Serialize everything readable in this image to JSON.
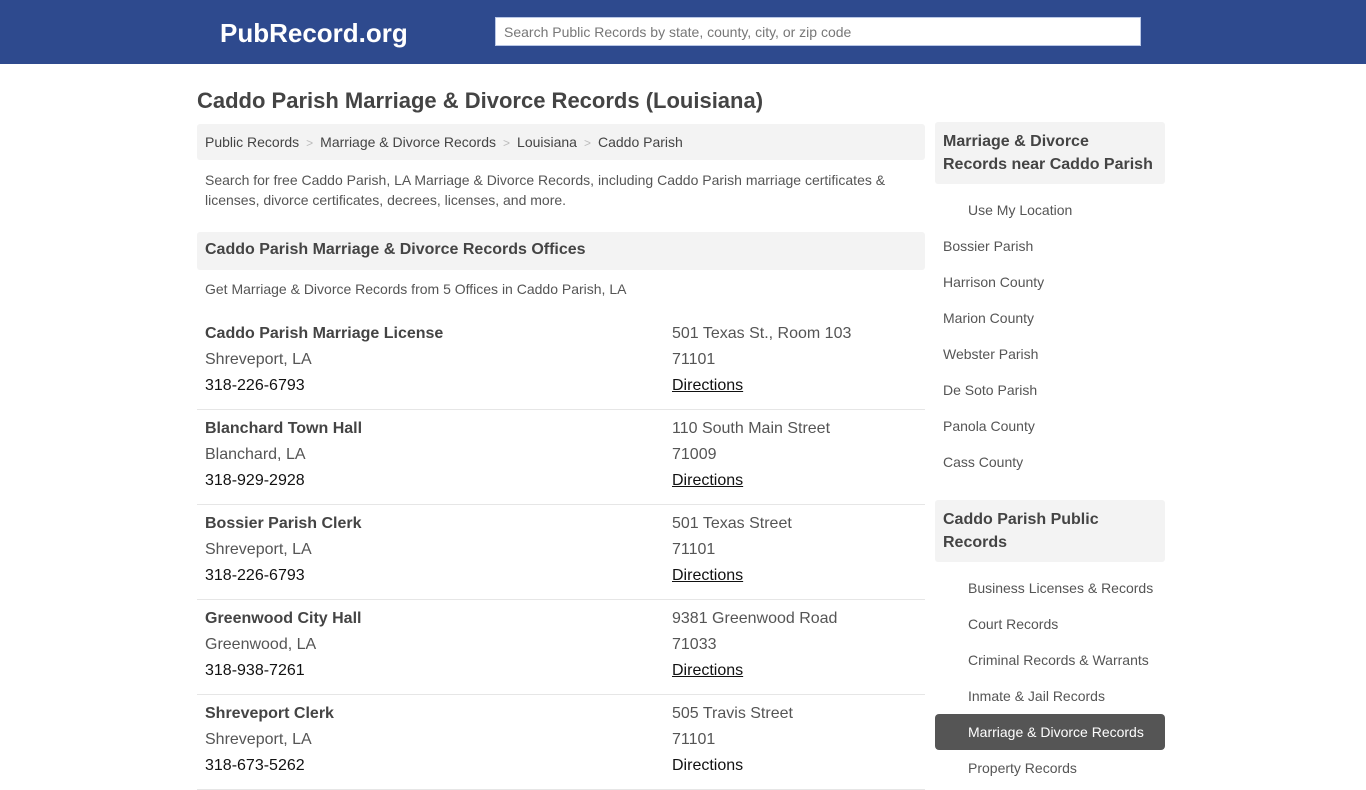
{
  "header": {
    "logo": "PubRecord.org",
    "search_placeholder": "Search Public Records by state, county, city, or zip code"
  },
  "page": {
    "title": "Caddo Parish Marriage & Divorce Records (Louisiana)",
    "breadcrumb": [
      "Public Records",
      "Marriage & Divorce Records",
      "Louisiana",
      "Caddo Parish"
    ],
    "breadcrumb_separator": ">",
    "intro": "Search for free Caddo Parish, LA Marriage & Divorce Records, including Caddo Parish marriage certificates & licenses, divorce certificates, decrees, licenses, and more.",
    "offices_heading": "Caddo Parish Marriage & Divorce Records Offices",
    "offices_subtext": "Get Marriage & Divorce Records from 5 Offices in Caddo Parish, LA",
    "offices": [
      {
        "name": "Caddo Parish Marriage License",
        "city": "Shreveport, LA",
        "phone": "318-226-6793",
        "address": "501 Texas St., Room 103",
        "zip": "71101",
        "directions": "Directions"
      },
      {
        "name": "Blanchard Town Hall",
        "city": "Blanchard, LA",
        "phone": "318-929-2928",
        "address": "110 South Main Street",
        "zip": "71009",
        "directions": "Directions"
      },
      {
        "name": "Bossier Parish Clerk",
        "city": "Shreveport, LA",
        "phone": "318-226-6793",
        "address": "501 Texas Street",
        "zip": "71101",
        "directions": "Directions"
      },
      {
        "name": "Greenwood City Hall",
        "city": "Greenwood, LA",
        "phone": "318-938-7261",
        "address": "9381 Greenwood Road",
        "zip": "71033",
        "directions": "Directions"
      },
      {
        "name": "Shreveport Clerk",
        "city": "Shreveport, LA",
        "phone": "318-673-5262",
        "address": "505 Travis Street",
        "zip": "71101",
        "directions": "Directions"
      }
    ]
  },
  "sidebar": {
    "nearby_heading": "Marriage & Divorce Records near Caddo Parish",
    "use_location": "Use My Location",
    "nearby": [
      "Bossier Parish",
      "Harrison County",
      "Marion County",
      "Webster Parish",
      "De Soto Parish",
      "Panola County",
      "Cass County"
    ],
    "public_heading": "Caddo Parish Public Records",
    "public_records": [
      {
        "label": "Business Licenses & Records",
        "active": false
      },
      {
        "label": "Court Records",
        "active": false
      },
      {
        "label": "Criminal Records & Warrants",
        "active": false
      },
      {
        "label": "Inmate & Jail Records",
        "active": false
      },
      {
        "label": "Marriage & Divorce Records",
        "active": true
      },
      {
        "label": "Property Records",
        "active": false
      }
    ]
  }
}
